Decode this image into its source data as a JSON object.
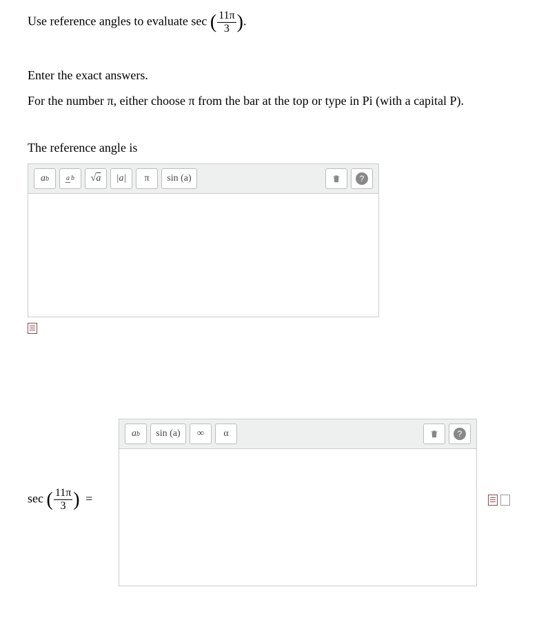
{
  "problem": {
    "line1_pre": "Use reference angles to evaluate sec",
    "frac_num": "11π",
    "frac_den": "3",
    "line1_post": ".",
    "enter_exact": "Enter the exact answers.",
    "pi_hint_pre": "For the number ",
    "pi_sym1": "π",
    "pi_hint_mid": ", either choose ",
    "pi_sym2": "π",
    "pi_hint_post": " from the bar at the top or type in Pi (with a capital P).",
    "ref_angle_label": "The reference angle is"
  },
  "editor1": {
    "btn_power_a": "a",
    "btn_power_b": "b",
    "btn_frac_a": "a",
    "btn_frac_b": "b",
    "btn_sqrt": "√a",
    "btn_abs": "|a|",
    "btn_pi": "π",
    "btn_sin": "sin (a)",
    "btn_help": "?"
  },
  "answer2": {
    "lhs_func": "sec",
    "frac_num": "11π",
    "frac_den": "3",
    "equals": "="
  },
  "editor2": {
    "btn_power_a": "a",
    "btn_power_b": "b",
    "btn_sin": "sin (a)",
    "btn_inf": "∞",
    "btn_alpha": "α",
    "btn_help": "?"
  }
}
